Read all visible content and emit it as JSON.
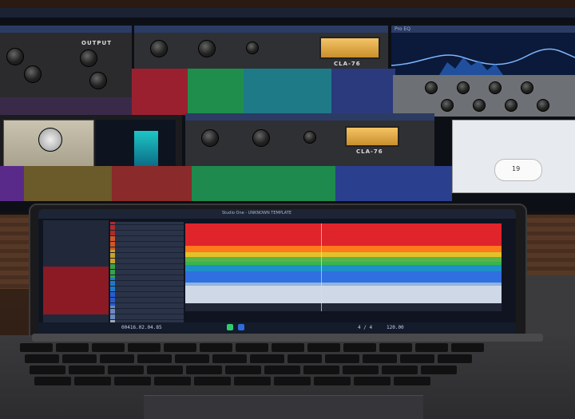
{
  "scene": {
    "description": "",
    "monitor": {
      "plugin_brands": [
        "CLA-76",
        "CLA-76",
        "Pro EQ"
      ],
      "output_label": "OUTPUT",
      "widget_value": "19"
    },
    "laptop": {
      "daw_title": "Studio One - UNKNOWN TEMPLATE",
      "transport_time": "00416.02.04.85",
      "tempo": "120.00",
      "time_sig": "4 / 4"
    }
  },
  "colors": {
    "lane_red": "#e0242b",
    "lane_orange": "#ff7a1c",
    "lane_yellow": "#e3c12a",
    "lane_green": "#39b54a",
    "lane_blue": "#2f6fe0",
    "lane_light": "#cfd8e6",
    "accent_daw": "#2d6cdf"
  }
}
